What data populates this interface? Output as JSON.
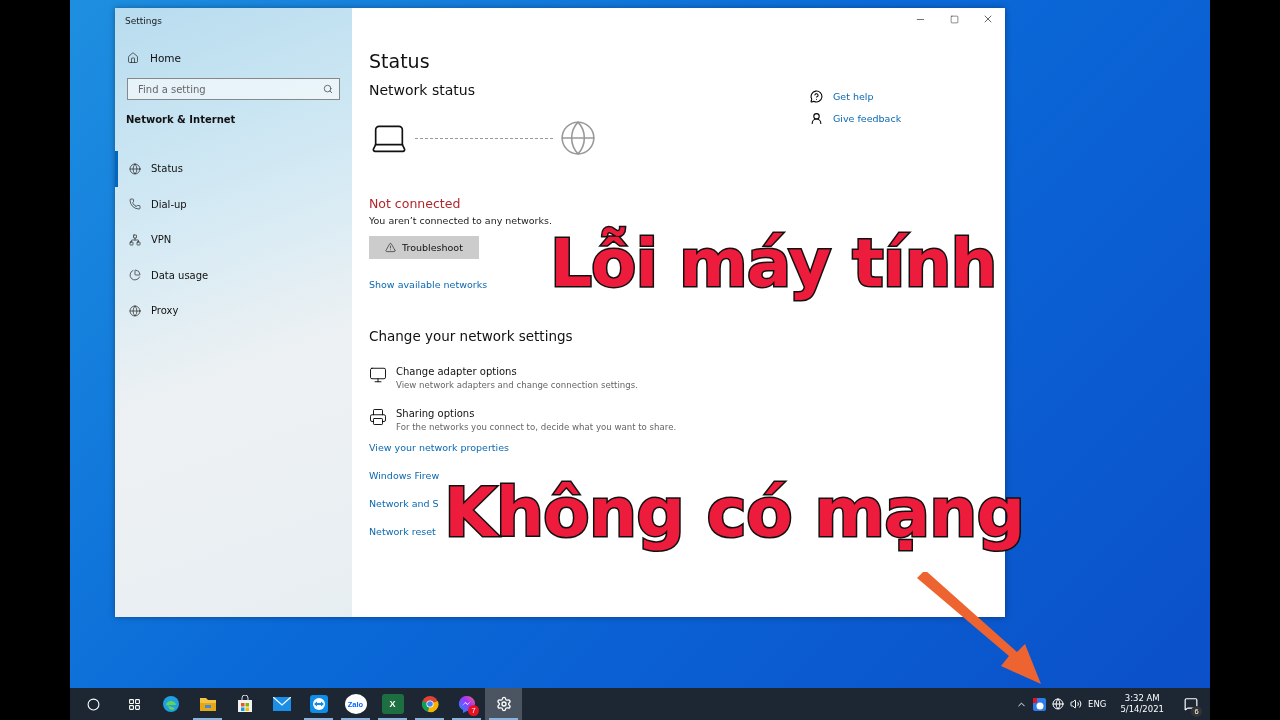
{
  "window": {
    "title": "Settings"
  },
  "sidebar": {
    "home": "Home",
    "search": {
      "placeholder": "Find a setting"
    },
    "section": "Network & Internet",
    "items": [
      {
        "label": "Status",
        "kind": "status",
        "selected": true
      },
      {
        "label": "Dial-up",
        "kind": "dialup",
        "selected": false
      },
      {
        "label": "VPN",
        "kind": "vpn",
        "selected": false
      },
      {
        "label": "Data usage",
        "kind": "data",
        "selected": false
      },
      {
        "label": "Proxy",
        "kind": "proxy",
        "selected": false
      }
    ]
  },
  "main": {
    "title": "Status",
    "subtitle": "Network status",
    "status": "Not connected",
    "message": "You aren’t connected to any networks.",
    "troubleshoot": "Troubleshoot",
    "show_networks": "Show available networks",
    "section": "Change your network settings",
    "options": [
      {
        "kind": "adapter",
        "title": "Change adapter options",
        "description": "View network adapters and change connection settings."
      },
      {
        "kind": "sharing",
        "title": "Sharing options",
        "description": "For the networks you connect to, decide what you want to share."
      }
    ],
    "links": [
      "View your network properties",
      "Windows Firew",
      "Network and S",
      "Network reset"
    ],
    "help": [
      {
        "kind": "help",
        "label": "Get help"
      },
      {
        "kind": "feedback",
        "label": "Give feedback"
      }
    ]
  },
  "overlay": [
    "Lỗi máy tính",
    "Không có mạng"
  ],
  "taskbar": {
    "apps": [
      {
        "kind": "edge",
        "running": false,
        "selected": false
      },
      {
        "kind": "explorer",
        "running": true,
        "selected": false
      },
      {
        "kind": "store",
        "running": false,
        "selected": false
      },
      {
        "kind": "mail",
        "running": false,
        "selected": false
      },
      {
        "kind": "teamviewer",
        "running": true,
        "selected": false
      },
      {
        "kind": "zalo",
        "label": "Zalo",
        "running": true,
        "selected": false
      },
      {
        "kind": "excel",
        "label": "X",
        "running": true,
        "selected": false
      },
      {
        "kind": "chrome",
        "running": true,
        "selected": false
      },
      {
        "kind": "messenger",
        "badge": "7",
        "running": true,
        "selected": false
      },
      {
        "kind": "settings",
        "running": true,
        "selected": true
      }
    ],
    "language": "ENG",
    "time": "3:32 AM",
    "date": "5/14/2021",
    "notifications": "6"
  }
}
